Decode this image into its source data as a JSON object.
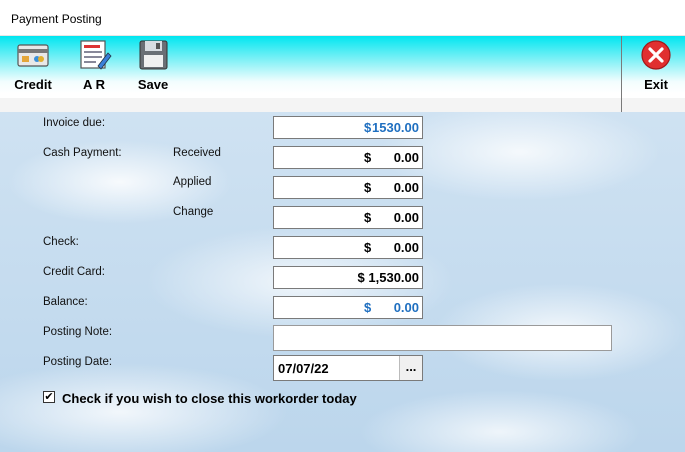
{
  "window": {
    "title": "Payment Posting"
  },
  "toolbar": {
    "credit_label": "Credit",
    "ar_label": "A R",
    "save_label": "Save",
    "exit_label": "Exit"
  },
  "form": {
    "invoice_due": {
      "label": "Invoice due:",
      "currency": "$",
      "value": "1530.00"
    },
    "cash_payment": {
      "label": "Cash Payment:",
      "received": {
        "label": "Received",
        "currency": "$",
        "value": "0.00"
      },
      "applied": {
        "label": "Applied",
        "currency": "$",
        "value": "0.00"
      },
      "change": {
        "label": "Change",
        "currency": "$",
        "value": "0.00"
      }
    },
    "check": {
      "label": "Check:",
      "currency": "$",
      "value": "0.00"
    },
    "credit_card": {
      "label": "Credit Card:",
      "value": "$ 1,530.00"
    },
    "balance": {
      "label": "Balance:",
      "currency": "$",
      "value": "0.00"
    },
    "posting_note": {
      "label": "Posting Note:",
      "value": ""
    },
    "posting_date": {
      "label": "Posting Date:",
      "value": "07/07/22",
      "button_label": "..."
    },
    "close_checkbox": {
      "label": "Check if you wish to close this workorder today",
      "checked": true,
      "mark": "✔"
    }
  },
  "colors": {
    "accent": "#00e6f0",
    "blue_value": "#1f6fc0",
    "exit_red": "#e03030"
  }
}
